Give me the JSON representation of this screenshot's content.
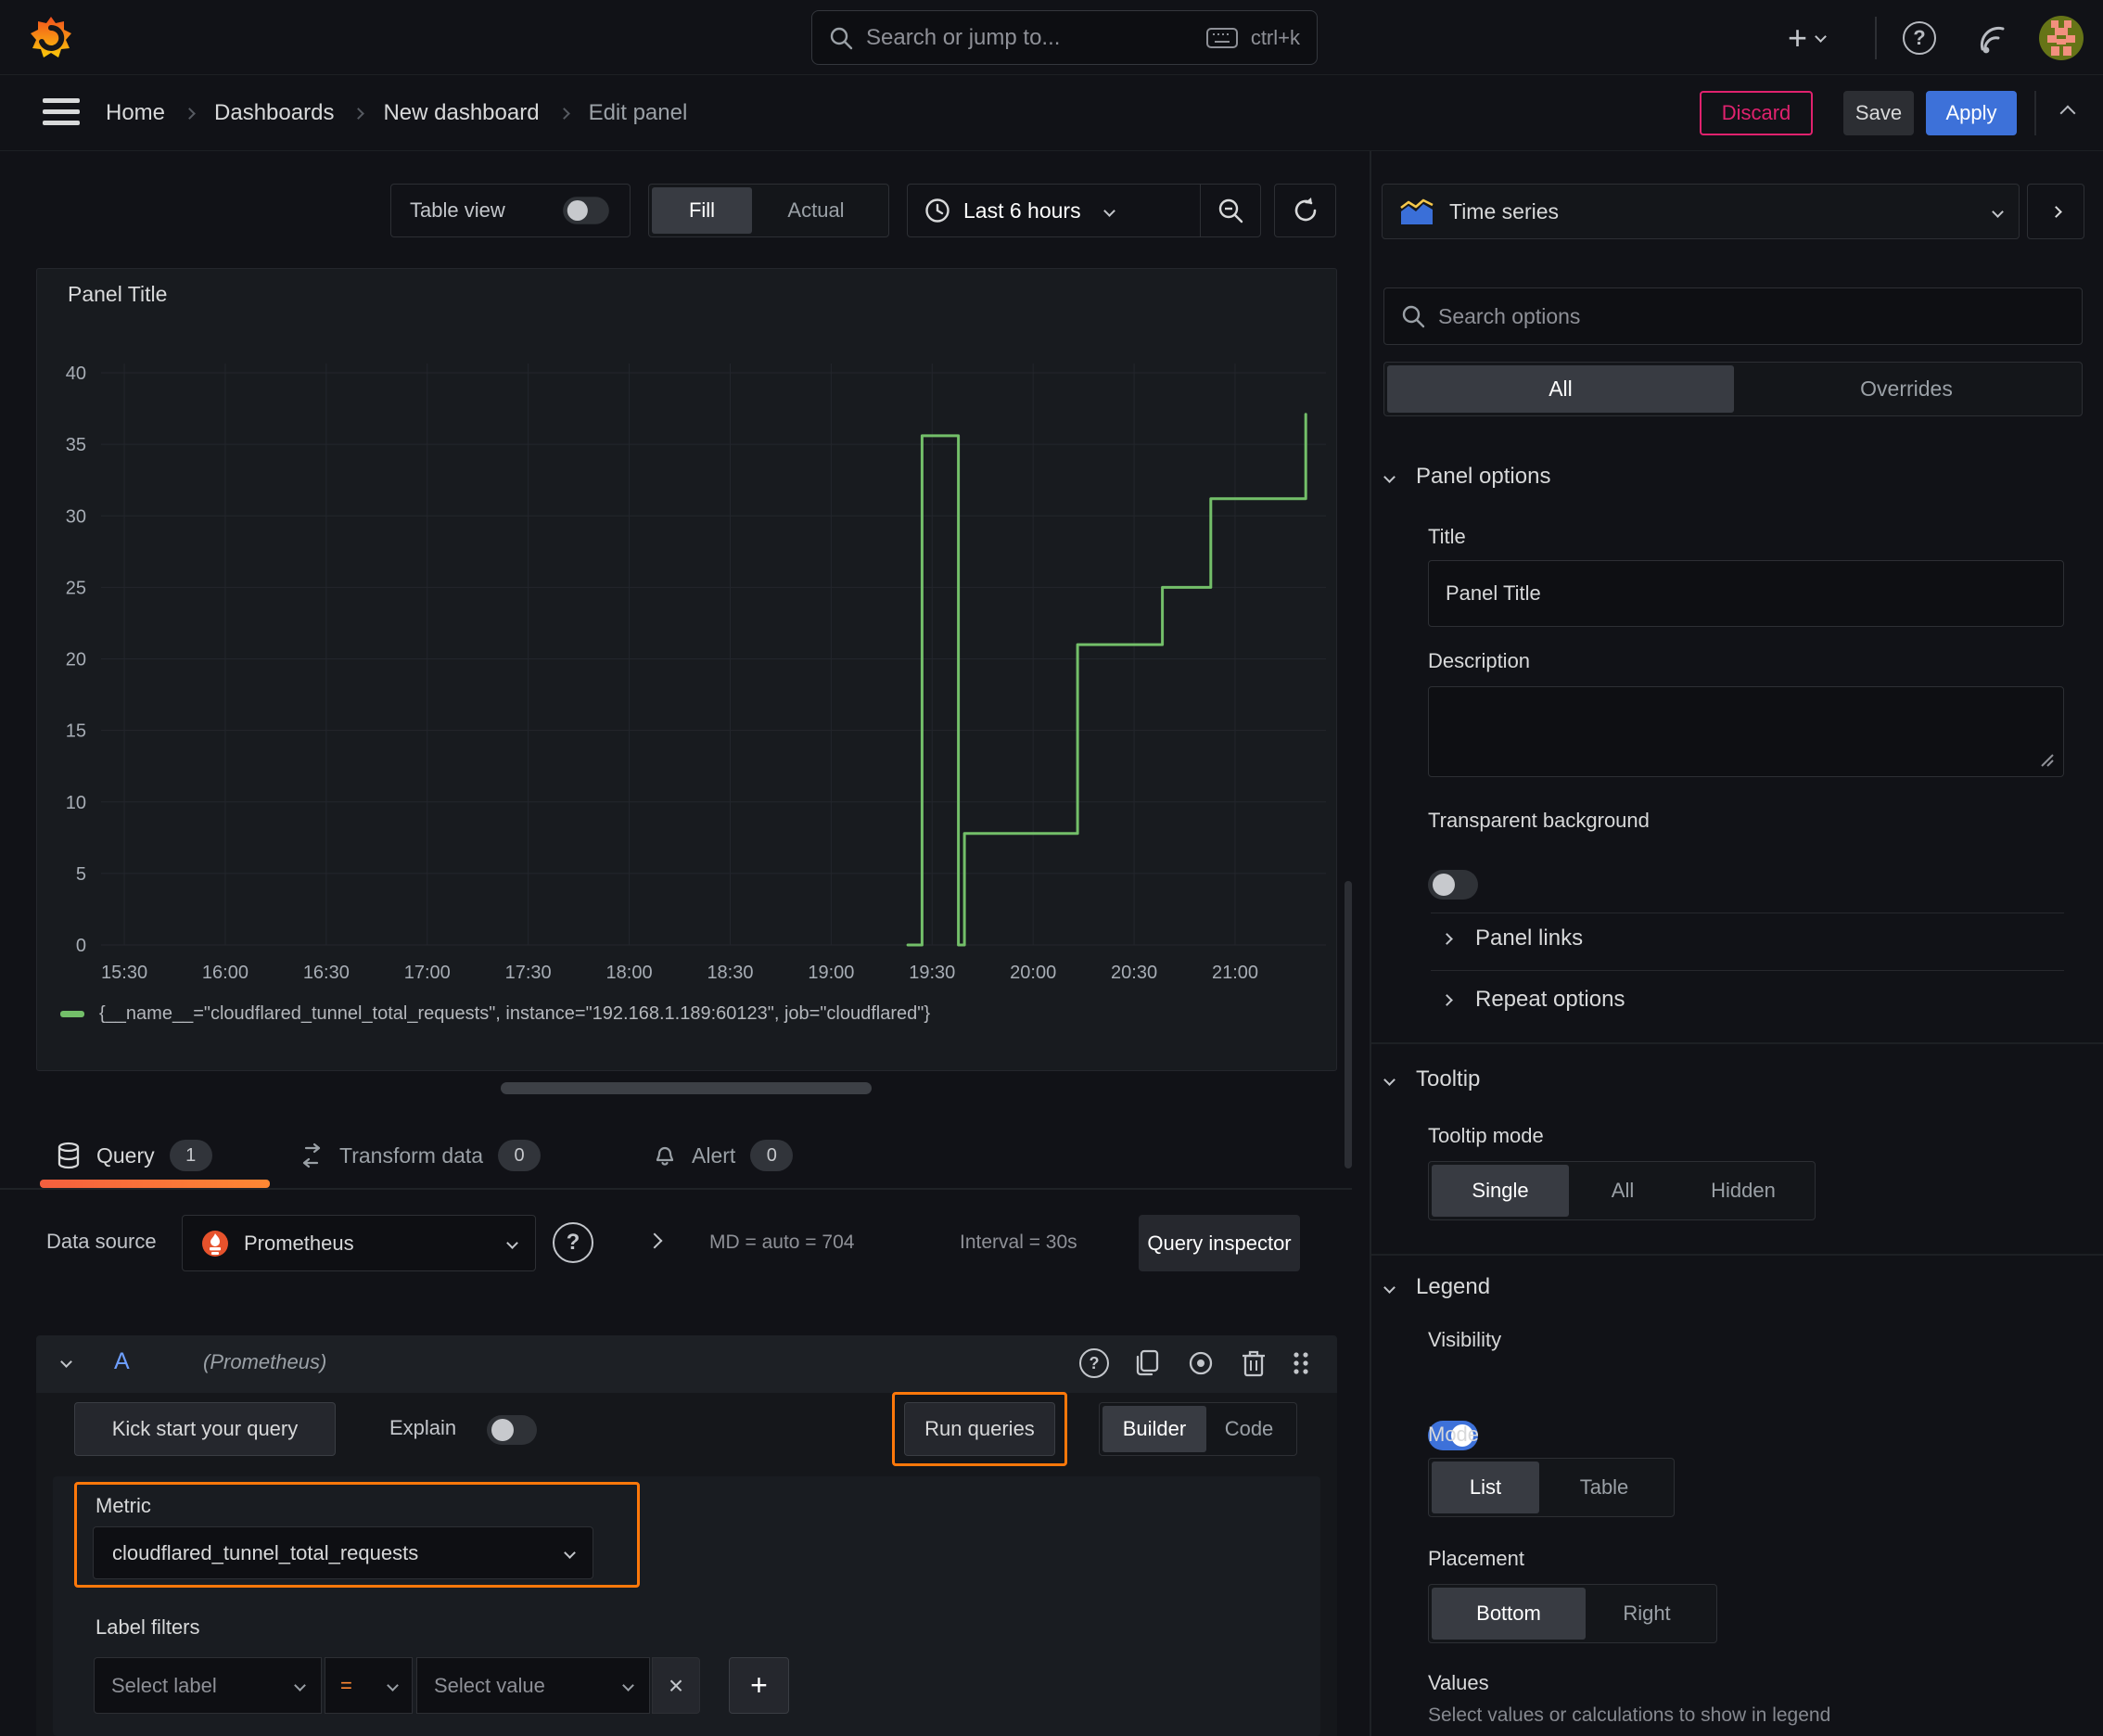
{
  "header": {
    "search_placeholder": "Search or jump to...",
    "search_shortcut": "ctrl+k"
  },
  "breadcrumb": {
    "home": "Home",
    "dashboards": "Dashboards",
    "dashboard": "New dashboard",
    "current": "Edit panel"
  },
  "actions": {
    "discard": "Discard",
    "save": "Save",
    "apply": "Apply"
  },
  "toolbar": {
    "table_view": "Table view",
    "fill": "Fill",
    "actual": "Actual",
    "time_range": "Last 6 hours"
  },
  "panel": {
    "title": "Panel Title"
  },
  "chart_data": {
    "type": "line",
    "step_interpolation": true,
    "title": "Panel Title",
    "xlabel": "",
    "ylabel": "",
    "x_range": [
      15.385,
      21.45
    ],
    "y_range": [
      0,
      40
    ],
    "grid": true,
    "legend_position": "bottom",
    "y_ticks": [
      0,
      5,
      10,
      15,
      20,
      25,
      30,
      35,
      40
    ],
    "x_ticks": [
      [
        15.5,
        "15:30"
      ],
      [
        16.0,
        "16:00"
      ],
      [
        16.5,
        "16:30"
      ],
      [
        17.0,
        "17:00"
      ],
      [
        17.5,
        "17:30"
      ],
      [
        18.0,
        "18:00"
      ],
      [
        18.5,
        "18:30"
      ],
      [
        19.0,
        "19:00"
      ],
      [
        19.5,
        "19:30"
      ],
      [
        20.0,
        "20:00"
      ],
      [
        20.5,
        "20:30"
      ],
      [
        21.0,
        "21:00"
      ]
    ],
    "series": [
      {
        "name": "{__name__=\"cloudflared_tunnel_total_requests\", instance=\"192.168.1.189:60123\", job=\"cloudflared\"}",
        "color": "#73BF69",
        "points": [
          [
            19.38,
            0
          ],
          [
            19.45,
            0
          ],
          [
            19.45,
            35.6
          ],
          [
            19.63,
            35.6
          ],
          [
            19.63,
            0
          ],
          [
            19.66,
            0
          ],
          [
            19.66,
            7.8
          ],
          [
            20.22,
            7.8
          ],
          [
            20.22,
            21
          ],
          [
            20.64,
            21
          ],
          [
            20.64,
            25
          ],
          [
            20.88,
            25
          ],
          [
            20.88,
            31.2
          ],
          [
            21.35,
            31.2
          ],
          [
            21.35,
            37.1
          ]
        ]
      }
    ]
  },
  "tabs": {
    "query": "Query",
    "query_count": "1",
    "transform": "Transform data",
    "transform_count": "0",
    "alert": "Alert",
    "alert_count": "0"
  },
  "datasource": {
    "label": "Data source",
    "name": "Prometheus",
    "md": "MD = auto = 704",
    "interval": "Interval = 30s",
    "inspector": "Query inspector"
  },
  "query": {
    "ref": "A",
    "datasource_hint": "(Prometheus)",
    "kick_start": "Kick start your query",
    "explain": "Explain",
    "run": "Run queries",
    "builder": "Builder",
    "code": "Code",
    "metric_label": "Metric",
    "metric_value": "cloudflared_tunnel_total_requests",
    "label_filters": "Label filters",
    "select_label": "Select label",
    "operator": "=",
    "select_value": "Select value"
  },
  "options": {
    "viz": "Time series",
    "search_placeholder": "Search options",
    "all": "All",
    "overrides": "Overrides",
    "panel_options": {
      "header": "Panel options",
      "title_label": "Title",
      "title_value": "Panel Title",
      "description_label": "Description",
      "transparent": "Transparent background"
    },
    "panel_links": "Panel links",
    "repeat_options": "Repeat options",
    "tooltip": {
      "header": "Tooltip",
      "mode_label": "Tooltip mode",
      "single": "Single",
      "all": "All",
      "hidden": "Hidden"
    },
    "legend": {
      "header": "Legend",
      "visibility": "Visibility",
      "mode_label": "Mode",
      "list": "List",
      "table": "Table",
      "placement_label": "Placement",
      "bottom": "Bottom",
      "right": "Right",
      "values_label": "Values",
      "values_help": "Select values or calculations to show in legend"
    }
  }
}
